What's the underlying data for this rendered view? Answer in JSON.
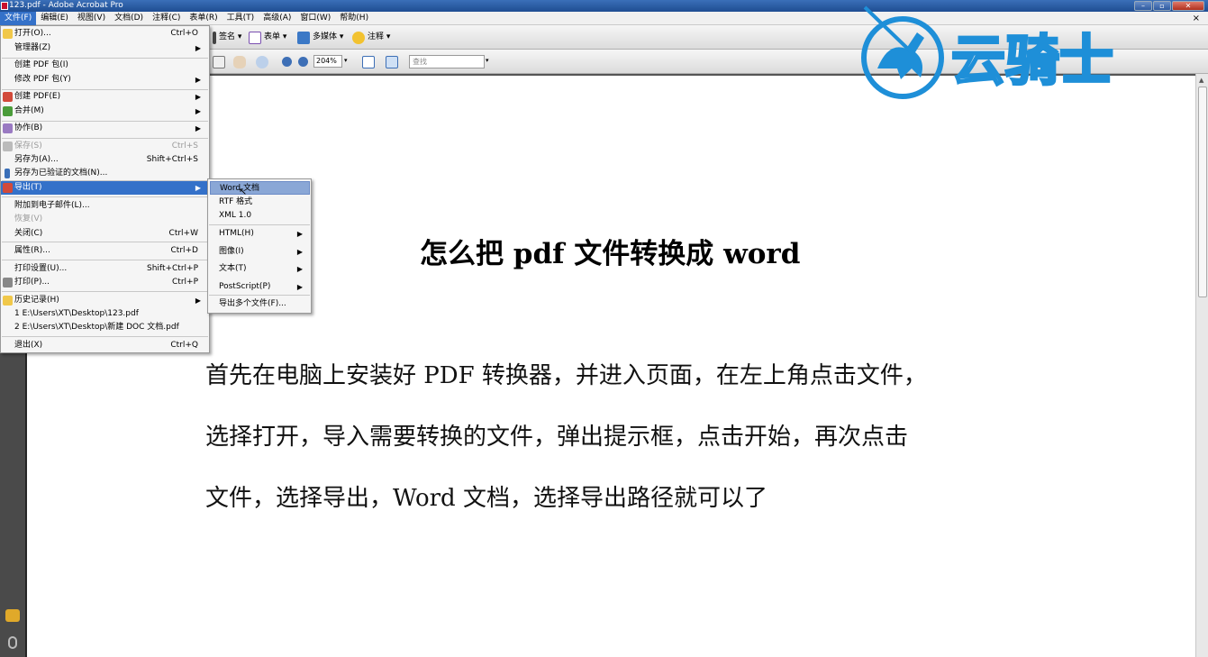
{
  "window": {
    "title": "123.pdf - Adobe Acrobat Pro",
    "min": "–",
    "max": "▫",
    "close": "✕"
  },
  "menubar": {
    "items": [
      "文件(F)",
      "编辑(E)",
      "视图(V)",
      "文档(D)",
      "注释(C)",
      "表单(R)",
      "工具(T)",
      "高级(A)",
      "窗口(W)",
      "帮助(H)"
    ],
    "doc_close": "×"
  },
  "toolbar": {
    "sign": "签名 ▾",
    "forms": "表单 ▾",
    "multimedia": "多媒体 ▾",
    "comment": "注释 ▾",
    "zoom": "204%",
    "zoom_arrow": "▾",
    "search_placeholder": "查找",
    "search_arrow": "▾"
  },
  "file_menu": {
    "open": "打开(O)...",
    "open_sc": "Ctrl+O",
    "organizer": "管理器(Z)",
    "create_package": "创建 PDF 包(I)",
    "modify_package": "修改 PDF 包(Y)",
    "create_pdf": "创建 PDF(E)",
    "combine": "合并(M)",
    "collaborate": "协作(B)",
    "save": "保存(S)",
    "save_sc": "Ctrl+S",
    "save_as": "另存为(A)...",
    "save_as_sc": "Shift+Ctrl+S",
    "save_certified": "另存为已验证的文档(N)...",
    "export": "导出(T)",
    "attach_email": "附加到电子邮件(L)...",
    "revert": "恢复(V)",
    "close": "关闭(C)",
    "close_sc": "Ctrl+W",
    "properties": "属性(R)...",
    "properties_sc": "Ctrl+D",
    "print_setup": "打印设置(U)...",
    "print_setup_sc": "Shift+Ctrl+P",
    "print": "打印(P)...",
    "print_sc": "Ctrl+P",
    "history": "历史记录(H)",
    "recent1": "1 E:\\Users\\XT\\Desktop\\123.pdf",
    "recent2": "2 E:\\Users\\XT\\Desktop\\新建 DOC 文档.pdf",
    "exit": "退出(X)",
    "exit_sc": "Ctrl+Q"
  },
  "export_menu": {
    "word": "Word 文档",
    "rtf": "RTF 格式",
    "xml": "XML 1.0",
    "html": "HTML(H)",
    "image": "图像(I)",
    "text": "文本(T)",
    "postscript": "PostScript(P)",
    "multiple": "导出多个文件(F)..."
  },
  "document": {
    "title": "怎么把 pdf 文件转换成 word",
    "lines": [
      "首先在电脑上安装好 PDF 转换器，并进入页面，在左上角点击文件，",
      "选择打开，导入需要转换的文件，弹出提示框，点击开始，再次点击",
      "文件，选择导出，Word 文档，选择导出路径就可以了"
    ]
  },
  "watermark": {
    "text": "云骑士",
    "color": "#1e8fd8"
  },
  "arrow_glyph": "▶"
}
